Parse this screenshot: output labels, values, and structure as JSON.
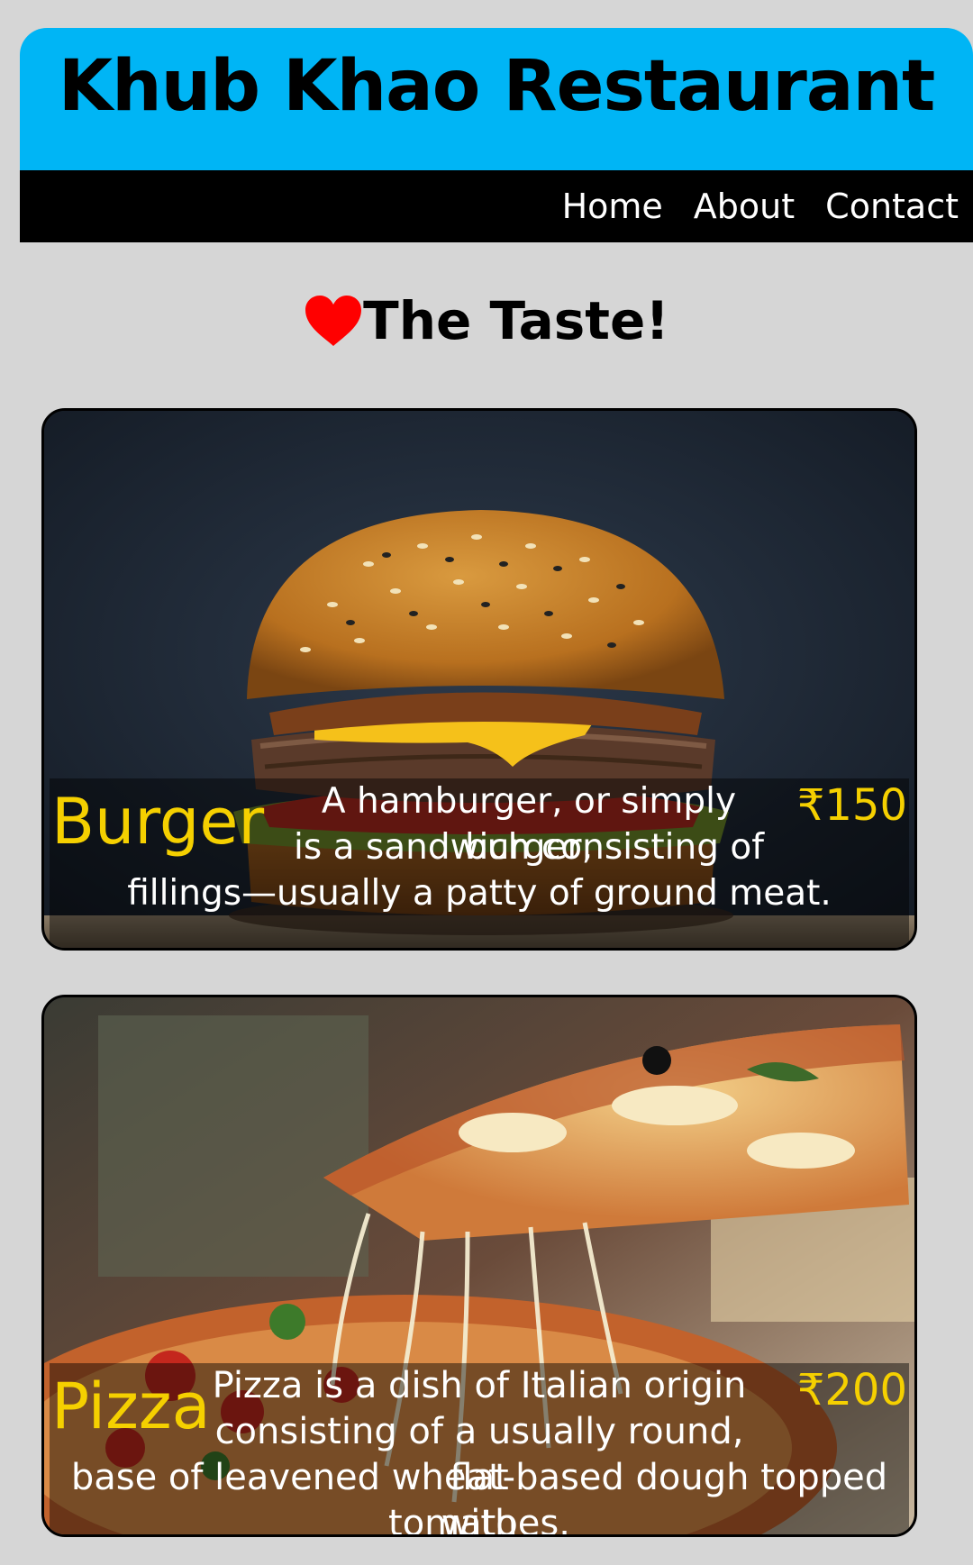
{
  "header": {
    "title": "Khub Khao Restaurant"
  },
  "nav": {
    "items": [
      "Home",
      "About",
      "Contact"
    ]
  },
  "tagline": {
    "text": "The Taste!",
    "icon": "heart-icon"
  },
  "menu": [
    {
      "name": "Burger",
      "price": "₹150",
      "description_lines": [
        "A hamburger, or simply burger,",
        "is a sandwich consisting of",
        "fillings—usually a patty of ground meat."
      ]
    },
    {
      "name": "Pizza",
      "price": "₹200",
      "description_lines": [
        "Pizza is a dish of Italian origin",
        "consisting of a usually round, flat",
        "base of leavened wheat-based dough topped with",
        "tomatoes."
      ]
    }
  ],
  "colors": {
    "header": "#00b5f5",
    "nav": "#000000",
    "accent": "#f5d000",
    "background": "#d6d6d6"
  }
}
